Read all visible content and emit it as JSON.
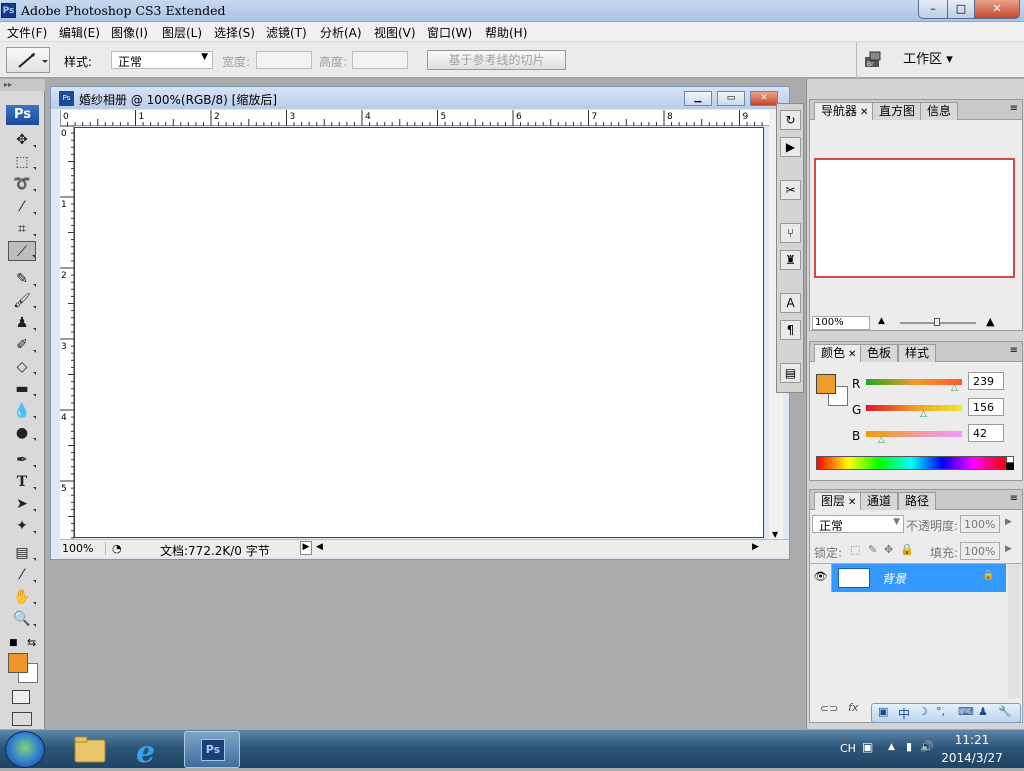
{
  "app": {
    "title": "Adobe Photoshop CS3 Extended",
    "ps_badge": "Ps"
  },
  "window_controls": {
    "minimize": "–",
    "maximize": "□",
    "close": "✕"
  },
  "menu": [
    "文件(F)",
    "编辑(E)",
    "图像(I)",
    "图层(L)",
    "选择(S)",
    "滤镜(T)",
    "分析(A)",
    "视图(V)",
    "窗口(W)",
    "帮助(H)"
  ],
  "options": {
    "style_label": "样式:",
    "style_value": "正常",
    "width_label": "宽度:",
    "height_label": "高度:",
    "slice_button": "基于参考线的切片",
    "workspace_button": "工作区 ▾"
  },
  "toolbox": {
    "logo": "Ps",
    "foreground_color": "#f0952a",
    "background_color": "#ffffff"
  },
  "document": {
    "title": "婚纱相册 @ 100%(RGB/8) [缩放后]",
    "ruler_top": [
      "0",
      "1",
      "2",
      "3",
      "4",
      "5",
      "6",
      "7",
      "8",
      "9"
    ],
    "ruler_left": [
      "0",
      "1",
      "2",
      "3",
      "4",
      "5"
    ],
    "zoom": "100%",
    "doc_info": "文档:772.2K/0 字节"
  },
  "navigator": {
    "tabs": [
      "导航器",
      "直方图",
      "信息"
    ],
    "zoom": "100%"
  },
  "color_panel": {
    "tabs": [
      "颜色",
      "色板",
      "样式"
    ],
    "channels": [
      {
        "label": "R",
        "value": "239"
      },
      {
        "label": "G",
        "value": "156"
      },
      {
        "label": "B",
        "value": "42"
      }
    ],
    "swatch": "#ef9c2a"
  },
  "layers_panel": {
    "tabs": [
      "图层",
      "通道",
      "路径"
    ],
    "blend_mode": "正常",
    "opacity_label": "不透明度:",
    "opacity": "100%",
    "lock_label": "锁定:",
    "fill_label": "填充:",
    "fill": "100%",
    "layers": [
      {
        "name": "背景",
        "selected": true
      }
    ]
  },
  "ime_bar": {
    "mode": "中"
  },
  "taskbar": {
    "lang": "CH",
    "time": "11:21",
    "date": "2014/3/27"
  }
}
